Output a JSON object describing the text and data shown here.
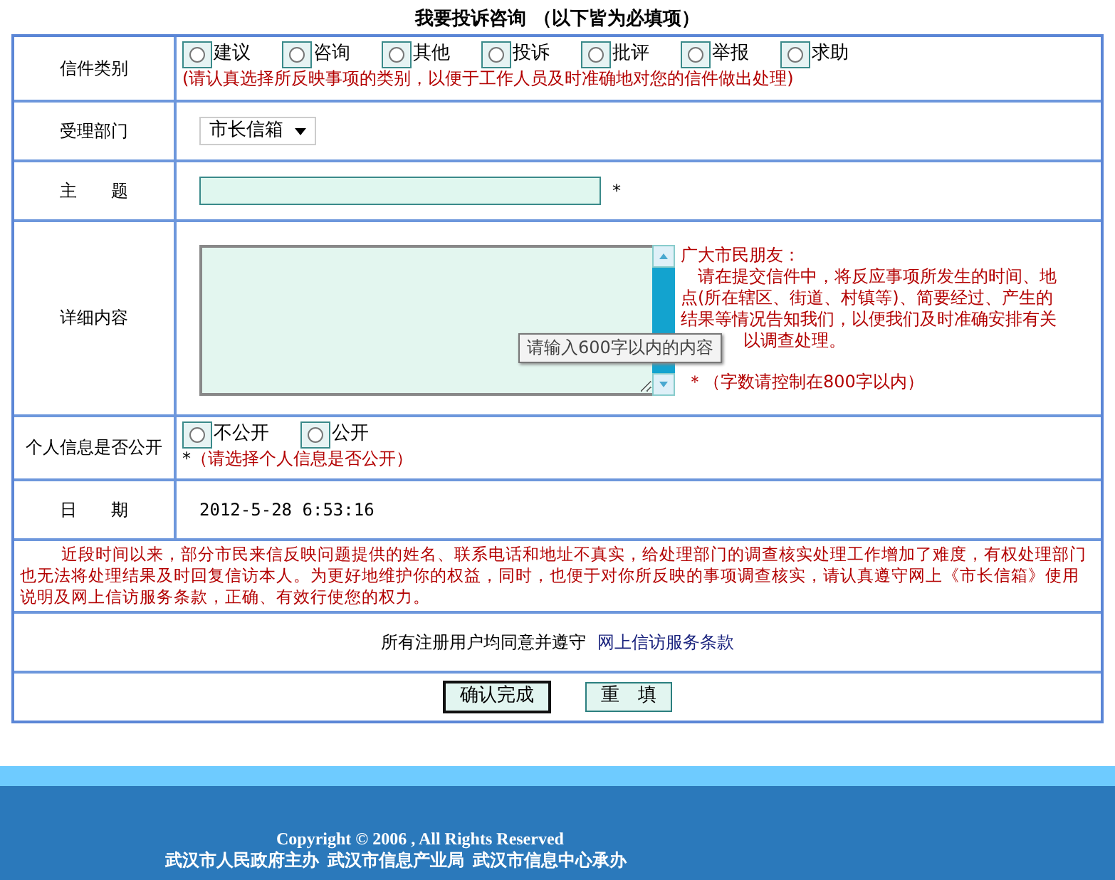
{
  "form_title": "我要投诉咨询 （以下皆为必填项）",
  "category": {
    "label": "信件类别",
    "options": [
      {
        "label": "建议",
        "selected": false
      },
      {
        "label": "咨询",
        "selected": false
      },
      {
        "label": "其他",
        "selected": false
      },
      {
        "label": "投诉",
        "selected": false
      },
      {
        "label": "批评",
        "selected": false
      },
      {
        "label": "举报",
        "selected": false
      },
      {
        "label": "求助",
        "selected": false
      }
    ],
    "hint": "(请认真选择所反映事项的类别，以便于工作人员及时准确地对您的信件做出处理)"
  },
  "department": {
    "label": "受理部门",
    "value": "市长信箱"
  },
  "subject": {
    "label": "主　　题",
    "required_mark": "*"
  },
  "detail": {
    "label": "详细内容",
    "hint_lines": [
      "广大市民朋友：",
      "　请在提交信件中，将反应事项所发生的时间、地",
      "点(所在辖区、街道、村镇等)、简要经过、产生的",
      "结果等情况告知我们，以便我们及时准确安排有关",
      "以调查处理。"
    ],
    "limit_note": "＊（字数请控制在800字以内）",
    "tooltip": "请输入600字以内的内容"
  },
  "privacy": {
    "label": "个人信息是否公开",
    "options": [
      {
        "label": "不公开",
        "selected": false
      },
      {
        "label": "公开",
        "selected": false
      }
    ],
    "hint_mark": "*",
    "hint": "（请选择个人信息是否公开）"
  },
  "date": {
    "label": "日　　期",
    "value": "2012-5-28 6:53:16"
  },
  "notice": "近段时间以来，部分市民来信反映问题提供的姓名、联系电话和地址不真实，给处理部门的调查核实处理工作增加了难度，有权处理部门也无法将处理结果及时回复信访本人。为更好地维护你的权益，同时，也便于对你所反映的事项调查核实，请认真遵守网上《市长信箱》使用说明及网上信访服务条款，正确、有效行使您的权力。",
  "agreement": {
    "text": "所有注册用户均同意并遵守",
    "link": "网上信访服务条款"
  },
  "buttons": [
    "确认完成",
    "重　填"
  ],
  "footer": {
    "copyright": "Copyright © 2006 , All Rights Reserved",
    "organizers": "武汉市人民政府主办  武汉市信息产业局  武汉市信息中心承办"
  }
}
